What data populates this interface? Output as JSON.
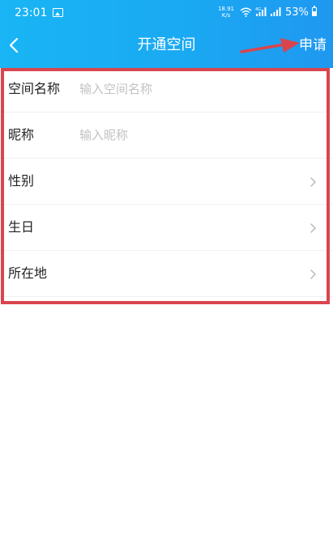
{
  "status_bar": {
    "time": "23:01",
    "net_speed": "18.91 K/s",
    "battery_percent": "53%",
    "icons": [
      "image-icon",
      "wifi-icon",
      "signal-4g-icon",
      "signal-icon",
      "battery-icon"
    ]
  },
  "header": {
    "title": "开通空间",
    "apply_label": "申请",
    "back_icon": "chevron-left-icon",
    "gradient_colors": [
      "#19b5f4",
      "#1f98f0"
    ]
  },
  "form": {
    "fields": [
      {
        "label": "空间名称",
        "placeholder": "输入空间名称"
      },
      {
        "label": "昵称",
        "placeholder": "输入昵称"
      }
    ],
    "selects": [
      {
        "label": "性别"
      },
      {
        "label": "生日"
      },
      {
        "label": "所在地"
      }
    ]
  },
  "annotation": {
    "color": "#d9454e",
    "shape": "rectangle-with-arrow"
  }
}
